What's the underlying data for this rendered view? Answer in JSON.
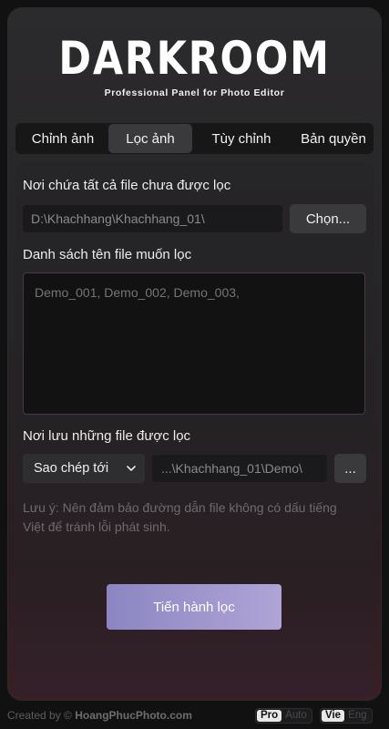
{
  "header": {
    "logo": "DARKROOM",
    "subtitle": "Professional Panel for Photo Editor"
  },
  "tabs": [
    {
      "label": "Chỉnh ảnh",
      "active": false
    },
    {
      "label": "Lọc ảnh",
      "active": true
    },
    {
      "label": "Tùy chỉnh",
      "active": false
    },
    {
      "label": "Bản quyền",
      "active": false
    }
  ],
  "source": {
    "label": "Nơi chứa tất cả file chưa được lọc",
    "path": "D:\\Khachhang\\Khachhang_01\\",
    "choose_label": "Chọn..."
  },
  "filelist": {
    "label": "Danh sách tên file muốn lọc",
    "placeholder": "Demo_001, Demo_002, Demo_003,"
  },
  "destination": {
    "label": "Nơi lưu những file được lọc",
    "mode": "Sao chép tới",
    "path": "...\\Khachhang_01\\Demo\\",
    "browse_label": "..."
  },
  "note": "Lưu ý: Nên đảm bảo đường dẫn file không có dấu tiếng Việt để tránh lỗi phát sinh.",
  "action": {
    "label": "Tiến hành lọc"
  },
  "footer": {
    "created_by": "Created by ©",
    "site": "HoangPhucPhoto.com",
    "mode_toggle": {
      "on": "Pro",
      "off": "Auto"
    },
    "lang_toggle": {
      "on": "Vie",
      "off": "Eng"
    }
  },
  "colors": {
    "accent_start": "#8b86c2",
    "accent_end": "#b0a4d6",
    "background": "#121112"
  }
}
